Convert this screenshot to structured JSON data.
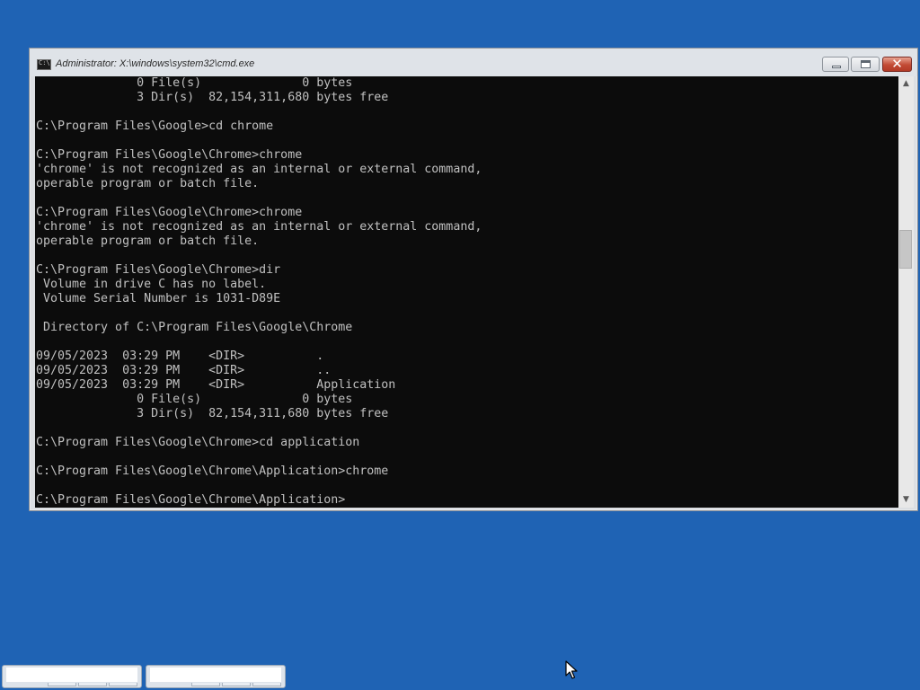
{
  "window": {
    "title": "Administrator: X:\\windows\\system32\\cmd.exe",
    "icon": "cmd-icon",
    "controls": {
      "minimize": "minimize-icon",
      "maximize": "restore-icon",
      "close_glyph": "✕"
    }
  },
  "console": {
    "lines": [
      "              0 File(s)              0 bytes",
      "              3 Dir(s)  82,154,311,680 bytes free",
      "",
      "C:\\Program Files\\Google>cd chrome",
      "",
      "C:\\Program Files\\Google\\Chrome>chrome",
      "'chrome' is not recognized as an internal or external command,",
      "operable program or batch file.",
      "",
      "C:\\Program Files\\Google\\Chrome>chrome",
      "'chrome' is not recognized as an internal or external command,",
      "operable program or batch file.",
      "",
      "C:\\Program Files\\Google\\Chrome>dir",
      " Volume in drive C has no label.",
      " Volume Serial Number is 1031-D89E",
      "",
      " Directory of C:\\Program Files\\Google\\Chrome",
      "",
      "09/05/2023  03:29 PM    <DIR>          .",
      "09/05/2023  03:29 PM    <DIR>          ..",
      "09/05/2023  03:29 PM    <DIR>          Application",
      "              0 File(s)              0 bytes",
      "              3 Dir(s)  82,154,311,680 bytes free",
      "",
      "C:\\Program Files\\Google\\Chrome>cd application",
      "",
      "C:\\Program Files\\Google\\Chrome\\Application>chrome",
      "",
      "C:\\Program Files\\Google\\Chrome\\Application>"
    ]
  },
  "scrollbar": {
    "up_arrow": "▲",
    "down_arrow": "▼"
  },
  "colors": {
    "desktop": "#1f63b4",
    "console_bg": "#0c0c0c",
    "console_text": "#c0c0c0",
    "close_button": "#c24a35"
  }
}
